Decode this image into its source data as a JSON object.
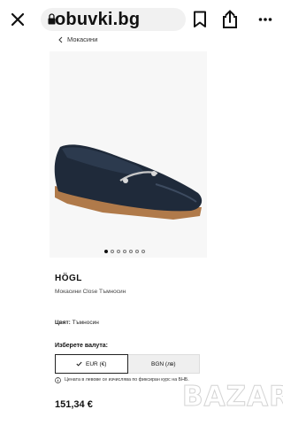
{
  "browser": {
    "close_icon": "close-icon",
    "url": "obuvki.bg",
    "lock_icon": "lock-icon",
    "bookmark_icon": "bookmark-icon",
    "share_icon": "share-icon",
    "more_icon": "more-icon"
  },
  "breadcrumb": {
    "label": "Мокасини"
  },
  "gallery": {
    "dots_total": 7,
    "active_index": 0
  },
  "product": {
    "brand": "HÖGL",
    "name": "Мокасини Close Тъмносин",
    "color_label": "Цвят:",
    "color_value": "Тъмносин"
  },
  "currency": {
    "label": "Изберете валута:",
    "options": [
      {
        "label": "EUR (€)",
        "active": true
      },
      {
        "label": "BGN (лв)",
        "active": false
      }
    ],
    "note": "Цената в левове се изчислява по фиксиран курс на БНБ."
  },
  "price": "151,34 €",
  "watermark": "BAZAR",
  "colors": {
    "shoe": "#1f2a3a",
    "sole": "#b07a4a",
    "accent": "#111111"
  }
}
